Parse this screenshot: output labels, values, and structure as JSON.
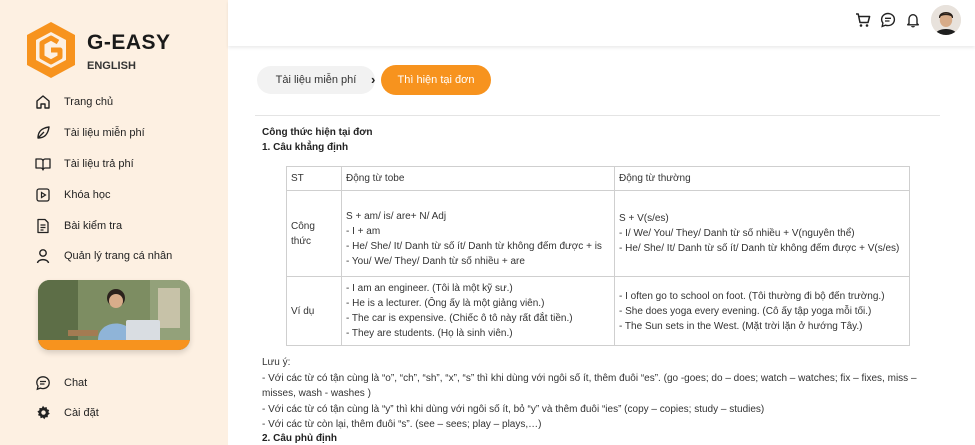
{
  "brand": {
    "name": "G-EASY",
    "subtitle": "ENGLISH",
    "accent": "#f7931e"
  },
  "sidebar": {
    "items": [
      {
        "label": "Trang chủ",
        "icon": "home-icon"
      },
      {
        "label": "Tài liệu miễn phí",
        "icon": "leaf-icon"
      },
      {
        "label": "Tài liệu trả phí",
        "icon": "book-icon"
      },
      {
        "label": "Khóa học",
        "icon": "video-icon"
      },
      {
        "label": "Bài kiểm tra",
        "icon": "document-icon"
      },
      {
        "label": "Quản lý trang cá nhân",
        "icon": "user-icon"
      }
    ],
    "bottom_items": [
      {
        "label": "Chat",
        "icon": "chat-icon"
      },
      {
        "label": "Cài đặt",
        "icon": "gear-icon"
      }
    ]
  },
  "header": {
    "icons": [
      "cart-icon",
      "message-icon",
      "bell-icon",
      "avatar"
    ]
  },
  "breadcrumb": {
    "parent": "Tài liệu miễn phí",
    "current": "Thì hiện tại đơn"
  },
  "article": {
    "title": "Công thức hiện tại đơn",
    "section1": "1. Câu khẳng định",
    "section2": "2. Câu phủ định",
    "table": {
      "headers": [
        "ST",
        "Động từ tobe",
        "Động từ thường"
      ],
      "formula": {
        "label": "Công thức",
        "tobe": [
          "S + am/ is/ are+ N/ Adj",
          "- I + am",
          "- He/ She/ It/ Danh từ số ít/ Danh từ không đếm được + is",
          "- You/ We/ They/ Danh từ số nhiều + are"
        ],
        "regular": [
          "S + V(s/es)",
          "- I/ We/ You/ They/ Danh từ số nhiều + V(nguyên thể)",
          "- He/ She/ It/ Danh từ số ít/ Danh từ không đếm được + V(s/es)"
        ]
      },
      "example": {
        "label": "Ví dụ",
        "tobe": [
          "- I am an engineer. (Tôi là một kỹ sư.)",
          "- He is a lecturer. (Ông ấy là một giảng viên.)",
          "- The car is expensive. (Chiếc ô tô này rất đắt tiền.)",
          "- They are students. (Họ là sinh viên.)"
        ],
        "regular": [
          "- I often go to school on foot. (Tôi thường đi bộ đến trường.)",
          "- She does yoga every evening. (Cô ấy tập yoga mỗi tối.)",
          "- The Sun sets in the West. (Mặt trời lặn ở hướng Tây.)"
        ]
      }
    },
    "notes": {
      "heading": "Lưu ý:",
      "lines": [
        "- Với các từ có tận cùng là “o”, “ch”, “sh”, “x”, “s” thì khi dùng với ngôi số ít, thêm đuôi “es”. (go -goes; do – does; watch – watches; fix – fixes, miss – misses, wash - washes )",
        "- Với các từ có tận cùng là “y” thì khi dùng với ngôi số ít, bỏ “y” và thêm đuôi “ies” (copy – copies; study – studies)",
        "- Với các từ còn lại, thêm đuôi “s”. (see – sees; play – plays,…)"
      ]
    }
  }
}
